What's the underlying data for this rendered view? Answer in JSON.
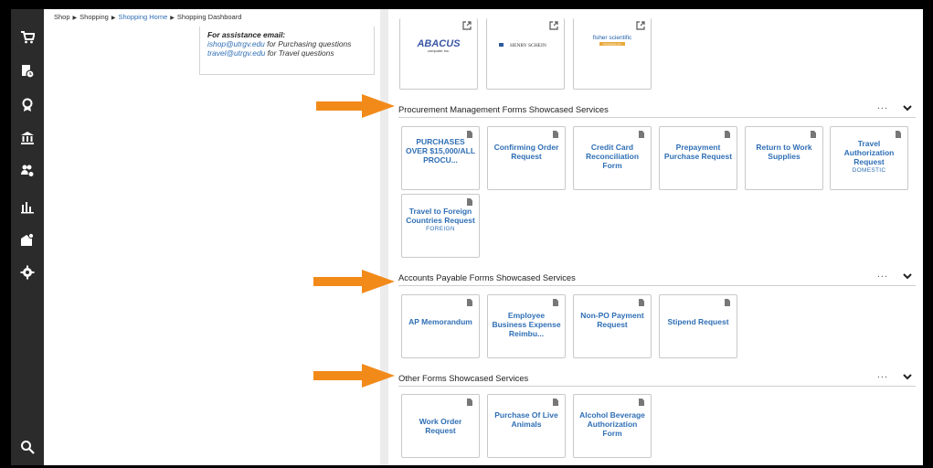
{
  "breadcrumb": {
    "items": [
      "Shop",
      "Shopping",
      "Shopping Home",
      "Shopping Dashboard"
    ]
  },
  "assistance": {
    "heading": "For assistance email:",
    "lines": [
      {
        "email": "ishop@utrgv.edu",
        "text": " for Purchasing questions"
      },
      {
        "email": "travel@utrgv.edu",
        "text": " for Travel questions"
      }
    ]
  },
  "sidebar": {
    "icons": [
      "cart-icon",
      "document-clock-icon",
      "award-icon",
      "bank-icon",
      "users-gear-icon",
      "bar-chart-icon",
      "building-gear-icon",
      "gear-icon",
      "search-icon"
    ]
  },
  "suppliers": {
    "logos": [
      {
        "name": "ABACUS",
        "tagline": "computer inc."
      },
      {
        "name": "HENRY SCHEIN",
        "tagline": ""
      },
      {
        "name": "fisher scientific",
        "tagline": "POWERED BY"
      }
    ]
  },
  "sections": [
    {
      "title": "Procurement Management Forms Showcased Services",
      "more": "...",
      "tiles": [
        {
          "label": "PURCHASES OVER $15,000/ALL PROCU...",
          "sub": ""
        },
        {
          "label": "Confirming Order Request",
          "sub": ""
        },
        {
          "label": "Credit Card Reconciliation Form",
          "sub": ""
        },
        {
          "label": "Prepayment Purchase Request",
          "sub": ""
        },
        {
          "label": "Return to Work Supplies",
          "sub": ""
        },
        {
          "label": "Travel Authorization Request",
          "sub": "DOMESTIC"
        },
        {
          "label": "Travel to Foreign Countries Request",
          "sub": "FOREIGN"
        }
      ]
    },
    {
      "title": "Accounts Payable Forms Showcased Services",
      "more": "...",
      "tiles": [
        {
          "label": "AP Memorandum",
          "sub": ""
        },
        {
          "label": "Employee Business Expense Reimbu...",
          "sub": ""
        },
        {
          "label": "Non-PO Payment Request",
          "sub": ""
        },
        {
          "label": "Stipend Request",
          "sub": ""
        }
      ]
    },
    {
      "title": "Other Forms Showcased Services",
      "more": "...",
      "tiles": [
        {
          "label": "Work Order Request",
          "sub": ""
        },
        {
          "label": "Purchase Of Live Animals",
          "sub": ""
        },
        {
          "label": "Alcohol Beverage Authorization Form",
          "sub": ""
        }
      ]
    }
  ],
  "colors": {
    "accent": "#2f6fb5",
    "annotation_arrow": "#f28a1a",
    "sidebar": "#2b2b2b"
  }
}
